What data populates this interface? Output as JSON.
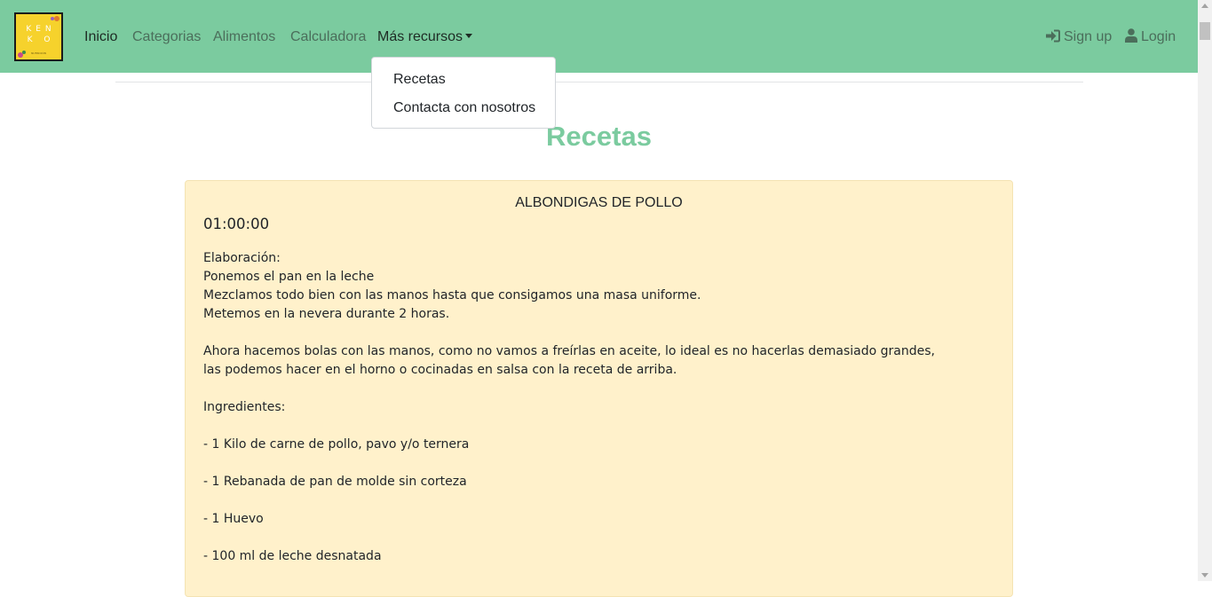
{
  "logo": {
    "line1": "KEN",
    "line2": "K O",
    "tagline": "NUTRICIÓN"
  },
  "nav": {
    "items": [
      {
        "label": "Inicio"
      },
      {
        "label": "Categorias"
      },
      {
        "label": "Alimentos"
      },
      {
        "label": "Calculadora"
      },
      {
        "label": "Más recursos"
      }
    ],
    "signup": "Sign up",
    "login": "Login"
  },
  "dropdown": {
    "items": [
      {
        "label": "Recetas"
      },
      {
        "label": "Contacta con nosotros"
      }
    ]
  },
  "page": {
    "title": "Recetas"
  },
  "recipe": {
    "title": "ALBONDIGAS DE POLLO",
    "time": "01:00:00",
    "lines": [
      "Elaboración:",
      "Ponemos el pan en la leche",
      "Mezclamos todo bien con las manos hasta que consigamos una masa uniforme.",
      "Metemos en la nevera durante 2 horas.",
      "",
      "Ahora hacemos bolas con las manos, como no vamos a freírlas en aceite, lo ideal es no hacerlas demasiado grandes,",
      "las podemos hacer en el horno o cocinadas en salsa con la receta de arriba.",
      "",
      "Ingredientes:",
      "",
      "- 1 Kilo de carne de pollo, pavo y/o ternera",
      "",
      "- 1 Rebanada de pan de molde sin corteza",
      "",
      "- 1 Huevo",
      "",
      "- 100 ml de leche desnatada"
    ]
  },
  "colors": {
    "navbar": "#7bcb9f",
    "title": "#7bcb9f",
    "card": "#fff1cb",
    "logo": "#f6d22c"
  },
  "icons": {
    "signup": "sign-in-icon",
    "login": "user-icon",
    "dropdown": "caret-down-icon"
  }
}
